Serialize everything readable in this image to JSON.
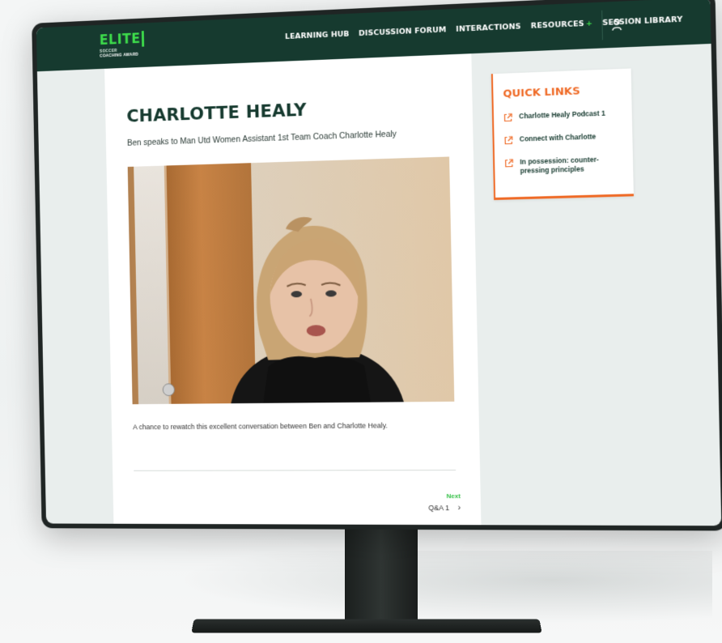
{
  "brand": {
    "logo_main": "ELITE",
    "logo_sub": "SOCCER",
    "logo_sub2": "COACHING AWARD"
  },
  "nav": {
    "items": [
      {
        "label": "LEARNING HUB"
      },
      {
        "label": "DISCUSSION FORUM"
      },
      {
        "label": "INTERACTIONS"
      },
      {
        "label": "RESOURCES"
      },
      {
        "label": "SESSION LIBRARY"
      }
    ],
    "resources_plus": "+"
  },
  "page": {
    "title": "CHARLOTTE HEALY",
    "subtitle": "Ben speaks to Man Utd Women Assistant 1st Team Coach Charlotte Healy",
    "caption": "A chance to rewatch this excellent conversation between Ben and Charlotte Healy."
  },
  "pager": {
    "next_label": "Next",
    "next_title": "Q&A 1"
  },
  "quick_links": {
    "title": "QUICK LINKS",
    "items": [
      {
        "label": "Charlotte Healy Podcast 1"
      },
      {
        "label": "Connect with Charlotte"
      },
      {
        "label": "In possession: counter-pressing principles"
      }
    ]
  },
  "colors": {
    "header_bg": "#163a2f",
    "accent_green": "#3ddc4b",
    "accent_orange": "#ef6a26"
  }
}
